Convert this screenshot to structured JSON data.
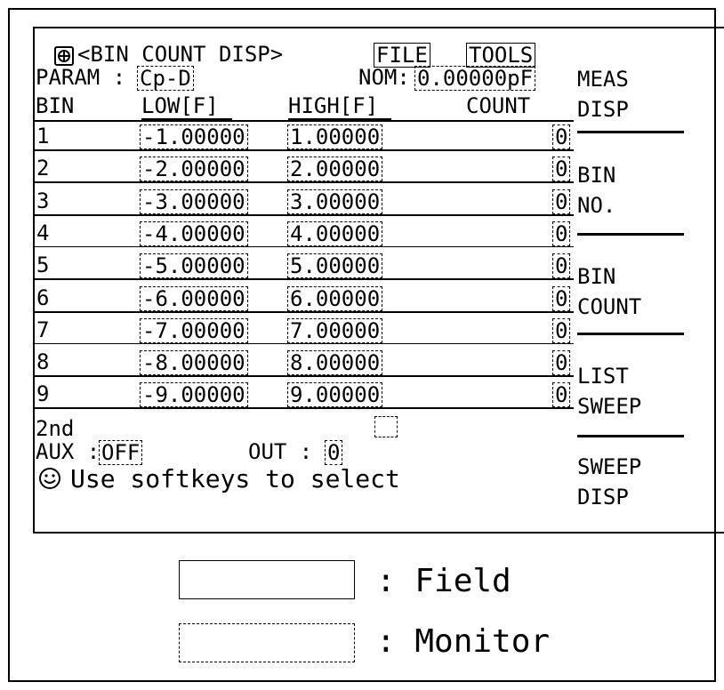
{
  "menu": {
    "active_page": "<BIN COUNT DISP>",
    "file_label": "FILE",
    "tools_label": "TOOLS"
  },
  "param": {
    "label": "PARAM :",
    "value": "Cp-D",
    "nom_label": "NOM:",
    "nom_value": "0.00000pF"
  },
  "table": {
    "headers": [
      "BIN",
      "LOW[F]",
      "HIGH[F]",
      "COUNT"
    ],
    "rows": [
      {
        "bin": "1",
        "low": "-1.00000",
        "high": "1.00000",
        "count": "0"
      },
      {
        "bin": "2",
        "low": "-2.00000",
        "high": "2.00000",
        "count": "0"
      },
      {
        "bin": "3",
        "low": "-3.00000",
        "high": "3.00000",
        "count": "0"
      },
      {
        "bin": "4",
        "low": "-4.00000",
        "high": "4.00000",
        "count": "0"
      },
      {
        "bin": "5",
        "low": "-5.00000",
        "high": "5.00000",
        "count": "0"
      },
      {
        "bin": "6",
        "low": "-6.00000",
        "high": "6.00000",
        "count": "0"
      },
      {
        "bin": "7",
        "low": "-7.00000",
        "high": "7.00000",
        "count": "0"
      },
      {
        "bin": "8",
        "low": "-8.00000",
        "high": "8.00000",
        "count": "0"
      },
      {
        "bin": "9",
        "low": "-9.00000",
        "high": "9.00000",
        "count": "0"
      }
    ]
  },
  "footer": {
    "second_label": "2nd",
    "aux_label": "AUX :",
    "aux_value": "OFF",
    "out_label": "OUT :",
    "out_value": "0",
    "help_text": "Use softkeys to select",
    "help_icon": "smiley-icon"
  },
  "softkeys": [
    {
      "line1": "MEAS",
      "line2": "DISP"
    },
    {
      "line1": "BIN",
      "line2": "NO."
    },
    {
      "line1": "BIN",
      "line2": "COUNT"
    },
    {
      "line1": "LIST",
      "line2": "SWEEP"
    },
    {
      "line1": "SWEEP",
      "line2": "DISP"
    }
  ],
  "legend": {
    "field_text": ": Field",
    "monitor_text": ": Monitor"
  }
}
